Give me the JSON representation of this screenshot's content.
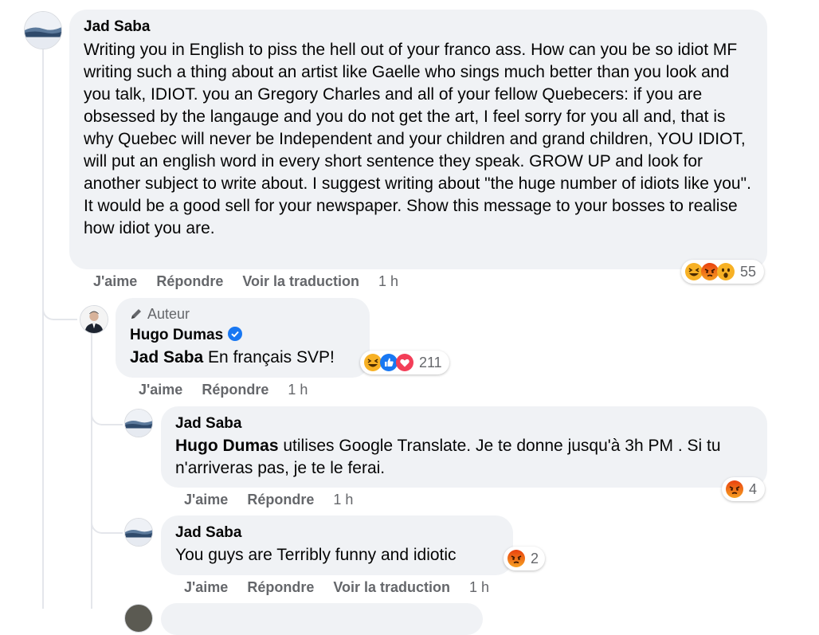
{
  "comments": [
    {
      "author": "Jad Saba",
      "text": "Writing you in English to piss the hell out of your franco ass. How can you be so idiot MF writing such a thing about an artist like Gaelle who sings much better than you look and you talk, IDIOT. you an Gregory Charles and all of your fellow Quebecers: if you are obsessed by the langauge and you do not get the art, I feel sorry for you all and, that is why Quebec will never be Independent and your children and grand children, YOU IDIOT, will put an english word in every short sentence they speak. GROW UP and look for another subject to write about. I suggest writing about \"the huge number of idiots like you\". It would be a good sell for your newspaper. Show this message to your bosses to realise how idiot you are.",
      "reactions": [
        "laugh",
        "angry",
        "wow"
      ],
      "reaction_count": "55",
      "actions": {
        "like": "J'aime",
        "reply": "Répondre",
        "translate": "Voir la traduction",
        "time": "1 h"
      }
    },
    {
      "badge": "Auteur",
      "author": "Hugo Dumas",
      "verified": true,
      "mention": "Jad Saba",
      "text": " En français SVP!",
      "reactions": [
        "laugh",
        "like",
        "love"
      ],
      "reaction_count": "211",
      "actions": {
        "like": "J'aime",
        "reply": "Répondre",
        "time": "1 h"
      }
    },
    {
      "author": "Jad Saba",
      "mention": "Hugo Dumas",
      "text": " utilises Google Translate. Je te donne jusqu'à 3h PM . Si tu n'arriveras pas, je te le ferai.",
      "reactions": [
        "angry"
      ],
      "reaction_count": "4",
      "actions": {
        "like": "J'aime",
        "reply": "Répondre",
        "time": "1 h"
      }
    },
    {
      "author": "Jad Saba",
      "text": "You guys are Terribly funny and idiotic",
      "reactions": [
        "angry"
      ],
      "reaction_count": "2",
      "actions": {
        "like": "J'aime",
        "reply": "Répondre",
        "translate": "Voir la traduction",
        "time": "1 h"
      }
    }
  ],
  "colors": {
    "bubble": "#f0f2f5",
    "secondary_text": "#65676b",
    "verified": "#1877f2",
    "like_blue": "#1877f2",
    "love_red": "#f33e58",
    "angry_orange": "#e9710f",
    "laugh_yellow": "#f7b125"
  }
}
